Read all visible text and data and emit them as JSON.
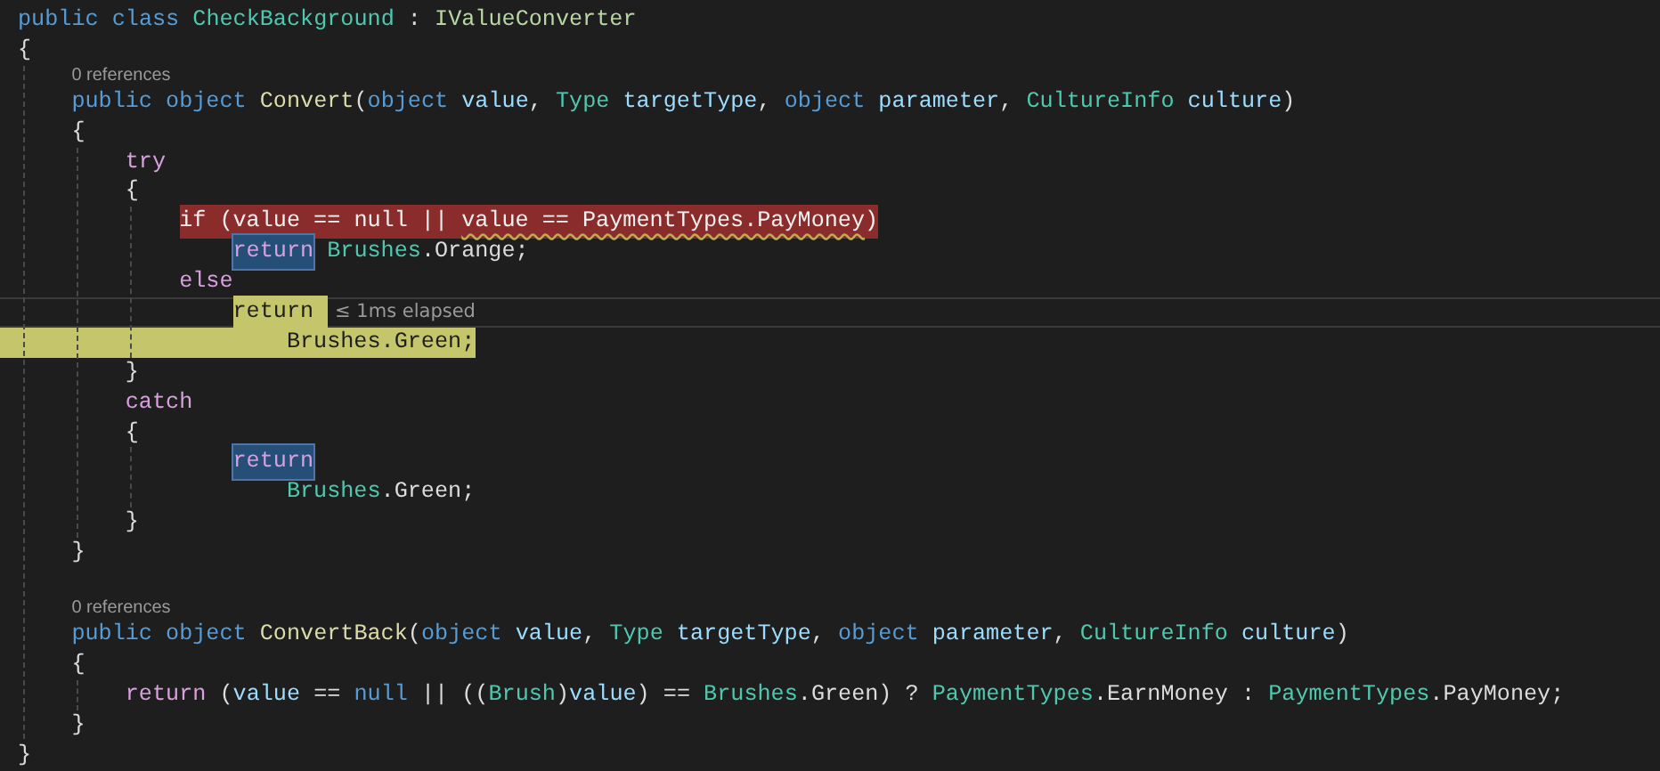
{
  "lines": [
    {
      "kind": "code",
      "tokens": [
        {
          "text": "public ",
          "kind": "keyword"
        },
        {
          "text": "class ",
          "kind": "keyword"
        },
        {
          "text": "CheckBackground",
          "kind": "type"
        },
        {
          "text": " : ",
          "kind": "plain"
        },
        {
          "text": "IValueConverter",
          "kind": "interface"
        }
      ]
    },
    {
      "kind": "block",
      "open": "{",
      "close": "}",
      "children": [
        {
          "kind": "lens",
          "text": "0 references"
        },
        {
          "kind": "code",
          "tokens": [
            {
              "text": "public object ",
              "kind": "keyword"
            },
            {
              "text": "Convert",
              "kind": "method"
            },
            {
              "text": "(",
              "kind": "plain"
            },
            {
              "text": "object ",
              "kind": "keyword"
            },
            {
              "text": "value",
              "kind": "param"
            },
            {
              "text": ", ",
              "kind": "plain"
            },
            {
              "text": "Type ",
              "kind": "type"
            },
            {
              "text": "targetType",
              "kind": "param"
            },
            {
              "text": ", ",
              "kind": "plain"
            },
            {
              "text": "object ",
              "kind": "keyword"
            },
            {
              "text": "parameter",
              "kind": "param"
            },
            {
              "text": ", ",
              "kind": "plain"
            },
            {
              "text": "CultureInfo ",
              "kind": "type"
            },
            {
              "text": "culture",
              "kind": "param"
            },
            {
              "text": ")",
              "kind": "plain"
            }
          ]
        },
        {
          "kind": "block",
          "open": "{",
          "close": "}",
          "children": [
            {
              "kind": "code",
              "tokens": [
                {
                  "text": "try",
                  "kind": "control"
                }
              ]
            },
            {
              "kind": "block",
              "open": "{",
              "close": "}",
              "children": [
                {
                  "kind": "code",
                  "tokens": [
                    {
                      "text": "if (value == null || ",
                      "breakpoint": true
                    },
                    {
                      "text": "value == PaymentTypes.PayMoney",
                      "breakpoint": true,
                      "warning": true
                    },
                    {
                      "text": ")",
                      "breakpoint": true
                    }
                  ],
                  "children": [
                    {
                      "kind": "code",
                      "tokens": [
                        {
                          "text": "return",
                          "kind": "control",
                          "reference": true
                        },
                        {
                          "text": " Brushes",
                          "kind": "type"
                        },
                        {
                          "text": ".Orange;",
                          "kind": "plain"
                        }
                      ]
                    }
                  ]
                },
                {
                  "kind": "code",
                  "tokens": [
                    {
                      "text": "else",
                      "kind": "control"
                    }
                  ],
                  "children": [
                    {
                      "kind": "code",
                      "perftip": "≤ 1ms elapsed",
                      "tokens": [
                        {
                          "text": "return",
                          "current": true
                        }
                      ],
                      "children": [
                        {
                          "kind": "code",
                          "current": true,
                          "tokens": [
                            {
                              "text": "Brushes.Green;"
                            }
                          ]
                        }
                      ]
                    }
                  ]
                }
              ]
            },
            {
              "kind": "code",
              "tokens": [
                {
                  "text": "catch",
                  "kind": "control"
                }
              ]
            },
            {
              "kind": "block",
              "open": "{",
              "close": "}",
              "children": [
                {
                  "kind": "nest",
                  "children": [
                    {
                      "kind": "code",
                      "tokens": [
                        {
                          "text": "return",
                          "kind": "control",
                          "reference": true
                        }
                      ],
                      "children": [
                        {
                          "kind": "code",
                          "tokens": [
                            {
                              "text": "Brushes",
                              "kind": "type"
                            },
                            {
                              "text": ".Green;",
                              "kind": "plain"
                            }
                          ]
                        }
                      ]
                    }
                  ]
                }
              ]
            }
          ]
        },
        {
          "kind": "blank"
        },
        {
          "kind": "lens",
          "text": "0 references"
        },
        {
          "kind": "code",
          "tokens": [
            {
              "text": "public object ",
              "kind": "keyword"
            },
            {
              "text": "ConvertBack",
              "kind": "method"
            },
            {
              "text": "(",
              "kind": "plain"
            },
            {
              "text": "object ",
              "kind": "keyword"
            },
            {
              "text": "value",
              "kind": "param"
            },
            {
              "text": ", ",
              "kind": "plain"
            },
            {
              "text": "Type ",
              "kind": "type"
            },
            {
              "text": "targetType",
              "kind": "param"
            },
            {
              "text": ", ",
              "kind": "plain"
            },
            {
              "text": "object ",
              "kind": "keyword"
            },
            {
              "text": "parameter",
              "kind": "param"
            },
            {
              "text": ", ",
              "kind": "plain"
            },
            {
              "text": "CultureInfo ",
              "kind": "type"
            },
            {
              "text": "culture",
              "kind": "param"
            },
            {
              "text": ")",
              "kind": "plain"
            }
          ]
        },
        {
          "kind": "block",
          "open": "{",
          "close": "}",
          "children": [
            {
              "kind": "code",
              "tokens": [
                {
                  "text": "return ",
                  "kind": "control"
                },
                {
                  "text": "(",
                  "kind": "plain"
                },
                {
                  "text": "value",
                  "kind": "param"
                },
                {
                  "text": " == ",
                  "kind": "plain"
                },
                {
                  "text": "null",
                  "kind": "keyword"
                },
                {
                  "text": " || ((",
                  "kind": "plain"
                },
                {
                  "text": "Brush",
                  "kind": "type"
                },
                {
                  "text": ")",
                  "kind": "plain"
                },
                {
                  "text": "value",
                  "kind": "param"
                },
                {
                  "text": ") == ",
                  "kind": "plain"
                },
                {
                  "text": "Brushes",
                  "kind": "type"
                },
                {
                  "text": ".Green) ? ",
                  "kind": "plain"
                },
                {
                  "text": "PaymentTypes",
                  "kind": "type"
                },
                {
                  "text": ".EarnMoney : ",
                  "kind": "plain"
                },
                {
                  "text": "PaymentTypes",
                  "kind": "type"
                },
                {
                  "text": ".PayMoney;",
                  "kind": "plain"
                }
              ]
            }
          ]
        }
      ]
    }
  ]
}
